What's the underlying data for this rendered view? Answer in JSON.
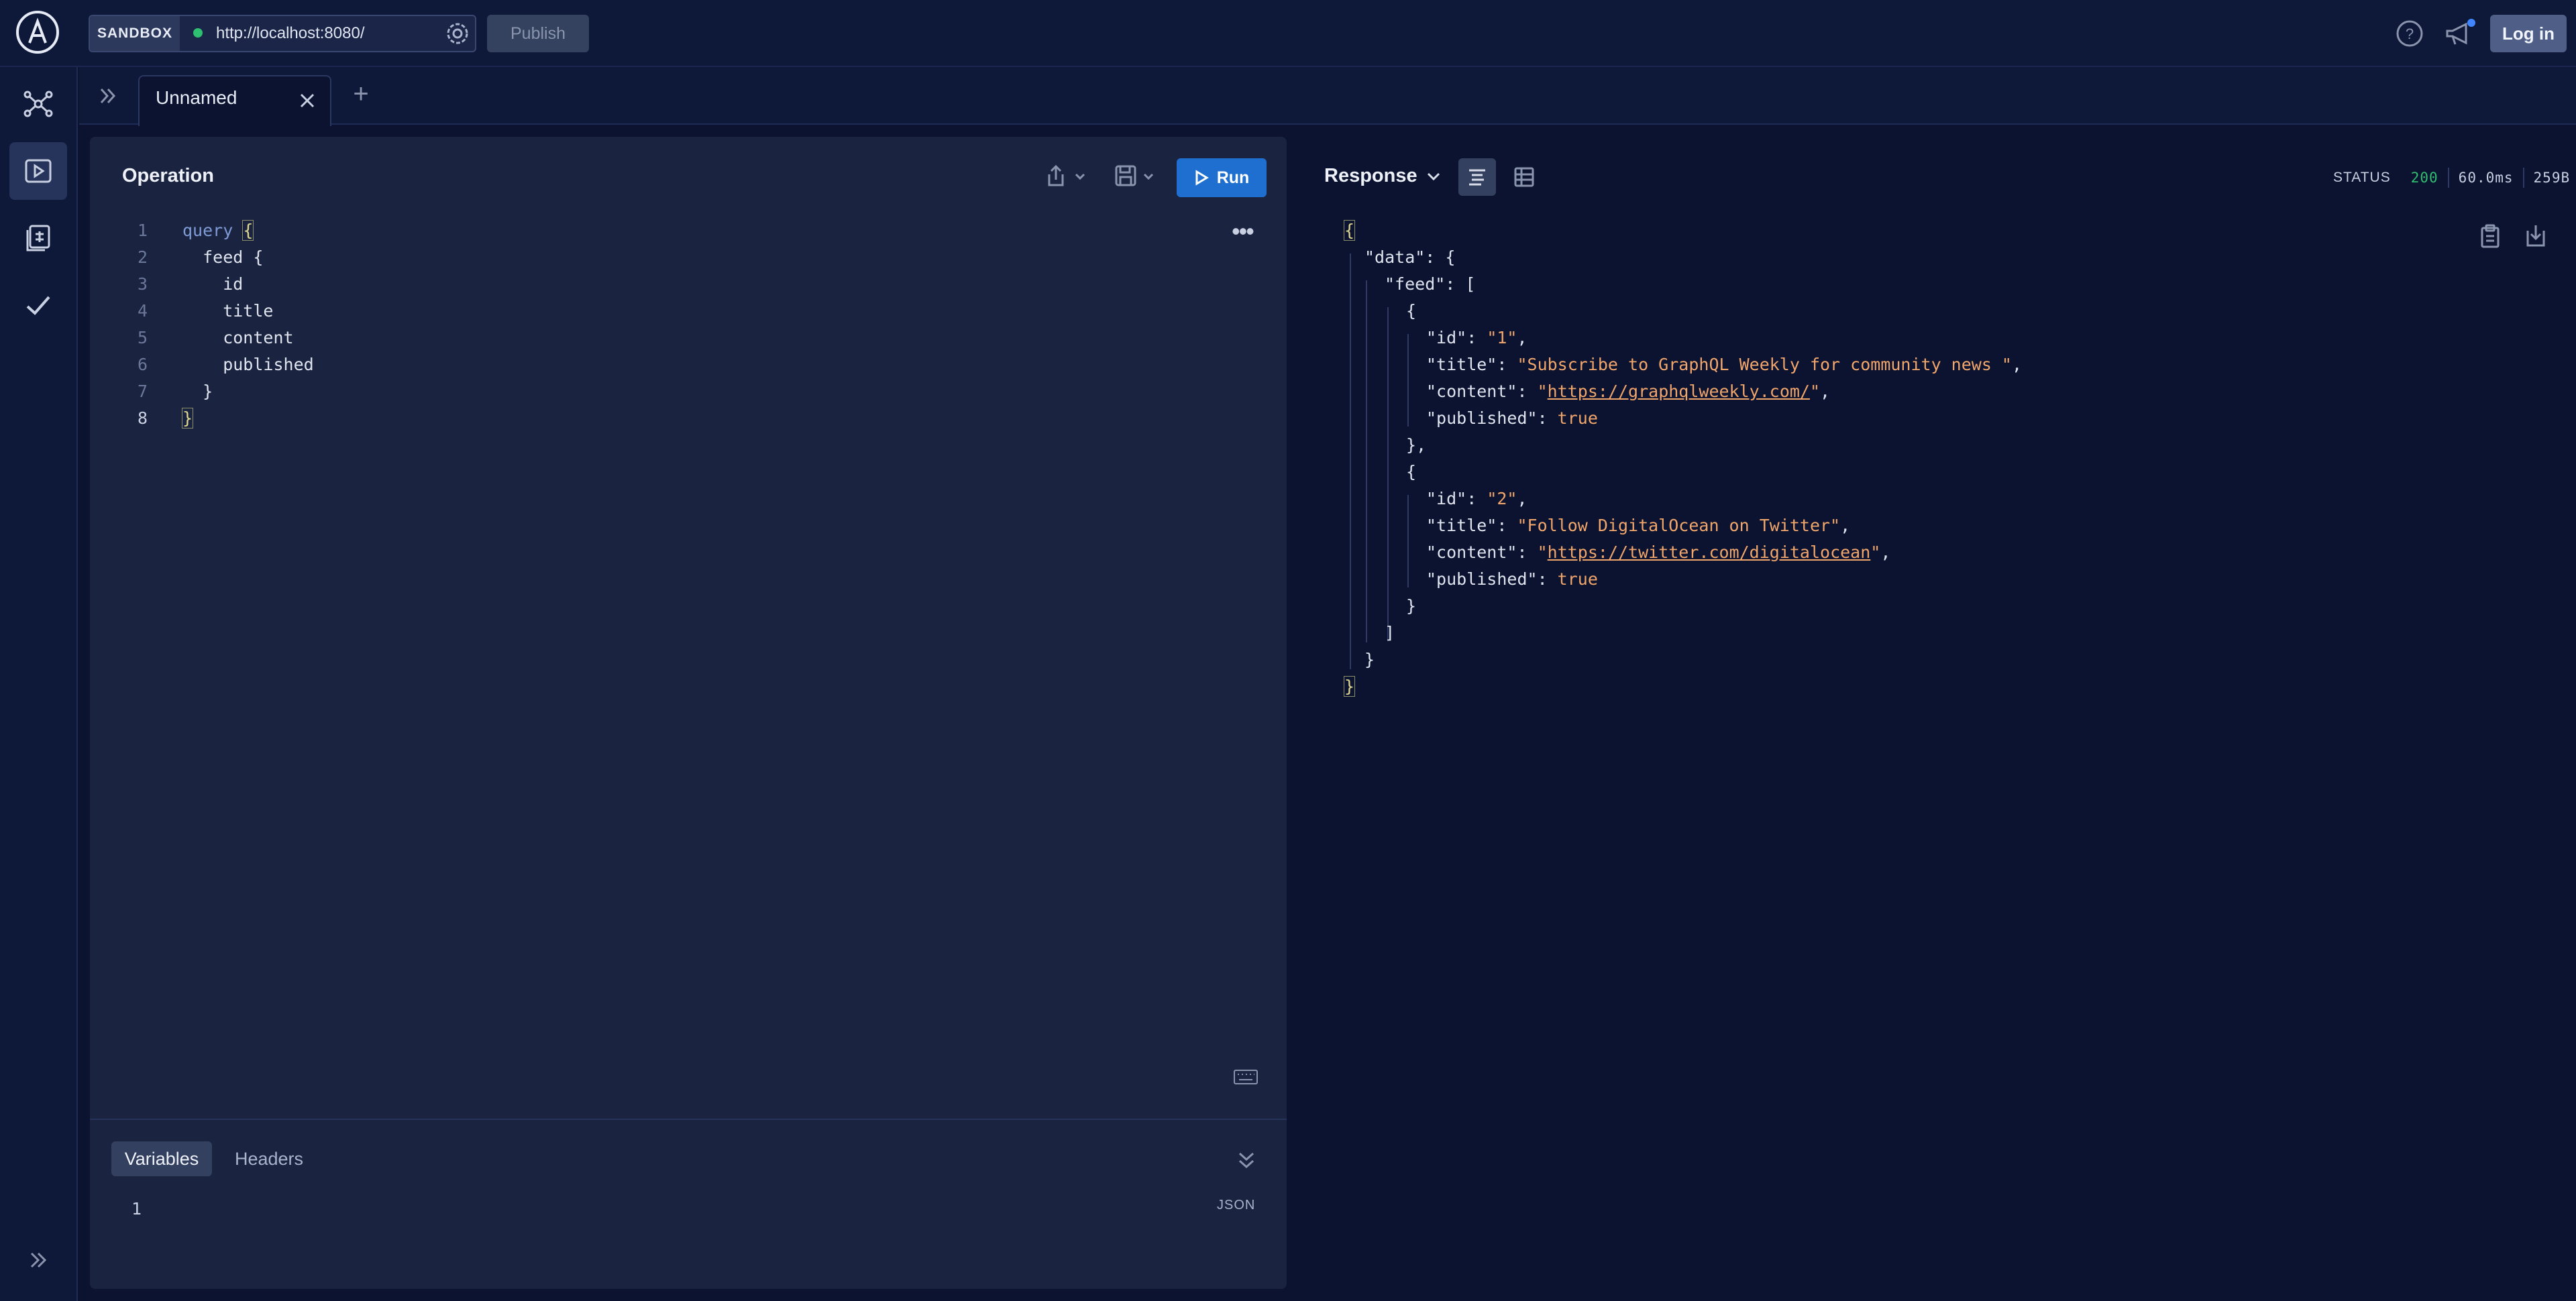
{
  "header": {
    "sandbox_label": "SANDBOX",
    "endpoint_url": "http://localhost:8080/",
    "publish_label": "Publish",
    "login_label": "Log in"
  },
  "sidebar": {
    "items": [
      {
        "name": "schema",
        "icon": "schema-graph-icon"
      },
      {
        "name": "explorer",
        "icon": "play-icon"
      },
      {
        "name": "collections",
        "icon": "collection-icon"
      },
      {
        "name": "checks",
        "icon": "checkmark-icon"
      }
    ]
  },
  "tabs": [
    {
      "label": "Unnamed"
    }
  ],
  "operation": {
    "title": "Operation",
    "run_label": "Run",
    "code": [
      {
        "n": "1",
        "text": "query {"
      },
      {
        "n": "2",
        "text": "  feed {"
      },
      {
        "n": "3",
        "text": "    id"
      },
      {
        "n": "4",
        "text": "    title"
      },
      {
        "n": "5",
        "text": "    content"
      },
      {
        "n": "6",
        "text": "    published"
      },
      {
        "n": "7",
        "text": "  }"
      },
      {
        "n": "8",
        "text": "}"
      }
    ]
  },
  "variables": {
    "tab_variables": "Variables",
    "tab_headers": "Headers",
    "line1": "1",
    "format_label": "JSON"
  },
  "response": {
    "title": "Response",
    "status_label": "STATUS",
    "status_code": "200",
    "time": "60.0ms",
    "size": "259B",
    "item1": {
      "id": "\"1\"",
      "title": "\"Subscribe to GraphQL Weekly for community news \"",
      "content": "https://graphqlweekly.com/",
      "published": "true"
    },
    "item2": {
      "id": "\"2\"",
      "title": "\"Follow DigitalOcean on Twitter\"",
      "content": "https://twitter.com/digitalocean",
      "published": "true"
    }
  },
  "colors": {
    "accent": "#1f6fd1",
    "status_ok": "#2fbf71",
    "json_string": "#f0a56b",
    "background": "#0b1330"
  }
}
